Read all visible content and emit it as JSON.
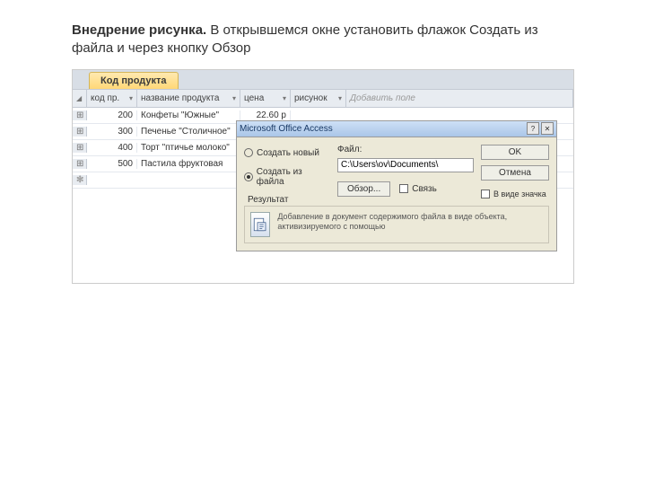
{
  "caption": {
    "bold": "Внедрение рисунка.",
    "rest": "В открывшемся окне установить флажок Создать из файла и через кнопку Обзор"
  },
  "tab": {
    "label": "Код продукта"
  },
  "columns": {
    "c1": "код пр.",
    "c2": "название продукта",
    "c3": "цена",
    "c4": "рисунок",
    "c5": "Добавить поле"
  },
  "rows": [
    {
      "id": "200",
      "name": "Конфеты \"Южные\"",
      "price": "22.60 р"
    },
    {
      "id": "300",
      "name": "Печенье \"Столичное\"",
      "price": ""
    },
    {
      "id": "400",
      "name": "Торт \"птичье молоко\"",
      "price": ""
    },
    {
      "id": "500",
      "name": "Пастила фруктовая",
      "price": ""
    }
  ],
  "dialog": {
    "title": "Microsoft Office Access",
    "radio_new": "Создать новый",
    "radio_file": "Создать из файла",
    "file_label": "Файл:",
    "file_value": "C:\\Users\\ov\\Documents\\",
    "browse": "Обзор...",
    "link": "Связь",
    "ok": "OK",
    "cancel": "Отмена",
    "asicon": "В виде значка",
    "result_label": "Результат",
    "result_text": "Добавление в документ содержимого файла в виде объекта, активизируемого с помощью"
  }
}
